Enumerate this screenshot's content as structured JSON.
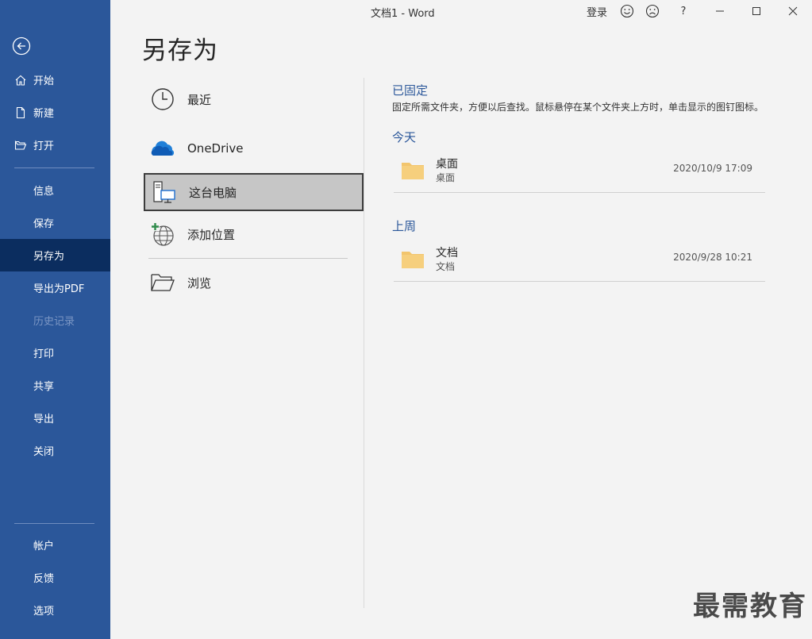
{
  "window": {
    "title": "文档1  -  Word",
    "signin": "登录",
    "help": "?"
  },
  "sidebar": {
    "items": [
      {
        "label": "开始",
        "icon": "home-icon"
      },
      {
        "label": "新建",
        "icon": "new-doc-icon"
      },
      {
        "label": "打开",
        "icon": "open-folder-icon"
      },
      {
        "label": "信息"
      },
      {
        "label": "保存"
      },
      {
        "label": "另存为",
        "active": true
      },
      {
        "label": "导出为PDF"
      },
      {
        "label": "历史记录",
        "disabled": true
      },
      {
        "label": "打印"
      },
      {
        "label": "共享"
      },
      {
        "label": "导出"
      },
      {
        "label": "关闭"
      },
      {
        "label": "帐户"
      },
      {
        "label": "反馈"
      },
      {
        "label": "选项"
      }
    ]
  },
  "page": {
    "title": "另存为"
  },
  "locations": [
    {
      "label": "最近",
      "icon": "clock-icon"
    },
    {
      "label": "OneDrive",
      "icon": "onedrive-cloud-icon"
    },
    {
      "label": "这台电脑",
      "icon": "this-pc-icon",
      "selected": true
    },
    {
      "label": "添加位置",
      "icon": "add-location-globe-icon"
    },
    {
      "label": "浏览",
      "icon": "browse-folder-icon"
    }
  ],
  "pinned": {
    "title": "已固定",
    "description": "固定所需文件夹，方便以后查找。鼠标悬停在某个文件夹上方时，单击显示的图钉图标。"
  },
  "groups": [
    {
      "title": "今天",
      "folders": [
        {
          "name": "桌面",
          "path": "桌面",
          "date": "2020/10/9 17:09"
        }
      ]
    },
    {
      "title": "上周",
      "folders": [
        {
          "name": "文档",
          "path": "文档",
          "date": "2020/9/28 10:21"
        }
      ]
    }
  ],
  "watermark": "最需教育",
  "colors": {
    "sidebar": "#2b579a",
    "sidebar_active": "#0b2d5f",
    "accent_text": "#2b579a",
    "folder": "#f2c56d"
  }
}
